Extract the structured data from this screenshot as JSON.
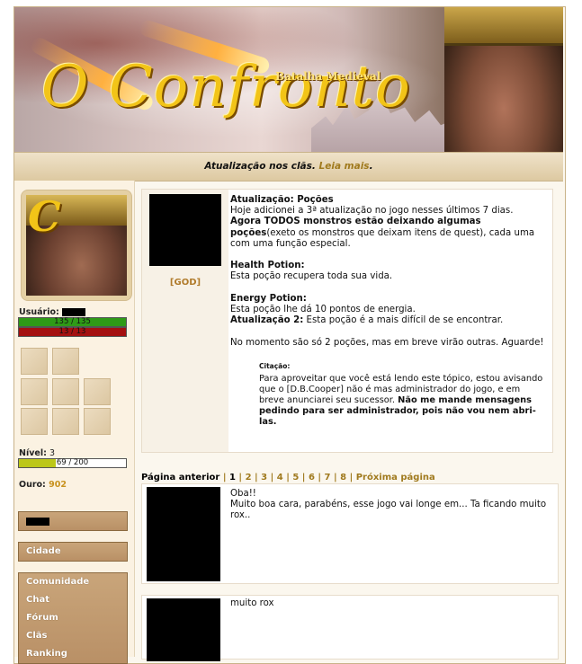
{
  "banner": {
    "title": "O Confronto",
    "subtitle": "Batalha Medieval"
  },
  "news": {
    "text": "Atualização nos clãs. ",
    "link": "Leia mais",
    "after": "."
  },
  "sidebar": {
    "user_label": "Usuário:",
    "hp": "135 / 135",
    "mp": "13 / 13",
    "level_label": "Nível:",
    "level_value": "3",
    "xp": "69 / 200",
    "xp_fraction": 0.345,
    "gold_label": "Ouro:",
    "gold_value": "902",
    "city": "Cidade",
    "menu": [
      "Comunidade",
      "Chat",
      "Fórum",
      "Clãs",
      "Ranking"
    ]
  },
  "post1": {
    "rank": "[GOD]",
    "h1": "Atualização: Poções",
    "l1": "Hoje adicionei a 3ª atualização no jogo nesses últimos 7 dias.",
    "l2b": "Agora TODOS monstros estão deixando algumas poções",
    "l2": "(exeto os monstros que deixam itens de quest), cada uma com uma função especial.",
    "h2": "Health Potion:",
    "l3": "Esta poção recupera toda sua vida.",
    "h3": "Energy Potion:",
    "l4": "Esta poção lhe dá 10 pontos de energia.",
    "l5b": "Atualização 2:",
    "l5": " Esta poção é a mais difícil de se encontrar.",
    "l6": "No momento são só 2 poções, mas em breve virão outras. Aguarde!",
    "quote_header": "Citação:",
    "quote": "Para aproveitar que você está lendo este tópico, estou avisando que o [D.B.Cooper] não é mas administrador do jogo, e em breve anunciarei seu sucessor. ",
    "quote_b": "Não me mande mensagens pedindo para ser administrador, pois não vou nem abri-las."
  },
  "pager": {
    "prev": "Página anterior",
    "pages": [
      "1",
      "2",
      "3",
      "4",
      "5",
      "6",
      "7",
      "8"
    ],
    "next": "Próxima página"
  },
  "post2": {
    "l1": "Oba!!",
    "l2": "Muito boa cara, parabéns, esse jogo vai longe em... Ta ficando muito rox.."
  },
  "post3": {
    "l1": "muito rox"
  }
}
